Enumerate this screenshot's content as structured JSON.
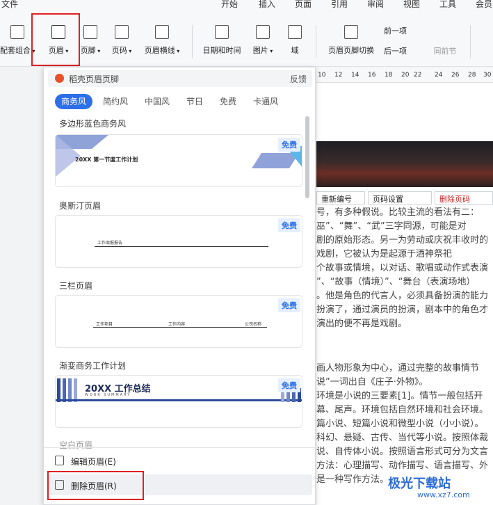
{
  "menubar": {
    "items": [
      "文件",
      "开始",
      "插入",
      "页面",
      "引用",
      "审阅",
      "视图",
      "工具",
      "会员"
    ]
  },
  "ribbon": {
    "buttons": [
      {
        "id": "combo",
        "label": "配套组合"
      },
      {
        "id": "header",
        "label": "页眉"
      },
      {
        "id": "footer",
        "label": "页脚"
      },
      {
        "id": "page-number",
        "label": "页码"
      },
      {
        "id": "header-line",
        "label": "页眉横线"
      },
      {
        "id": "datetime",
        "label": "日期和时间"
      },
      {
        "id": "picture",
        "label": "图片"
      },
      {
        "id": "field",
        "label": "域"
      },
      {
        "id": "switch",
        "label": "页眉页脚切换"
      },
      {
        "id": "prev",
        "label": "前一项"
      },
      {
        "id": "next",
        "label": "后一项"
      },
      {
        "id": "same",
        "label": "同前节"
      }
    ]
  },
  "ruler": {
    "ticks": [
      "10",
      "12",
      "14",
      "16",
      "18",
      "20",
      "22",
      "24",
      "26",
      "28",
      "30"
    ]
  },
  "header_toolbar": {
    "renumber": "重新编号",
    "page_number_settings": "页码设置",
    "delete_page_number": "删除页码"
  },
  "document_lines": [
    "号，有多种假说。比较主流的看法有二：",
    "巫”、“舞”、“武”三字同源，可能是对",
    "剧的原始形态。另一为劳动或庆祝丰收时的",
    "戏剧，它被认为是起源于酒神祭祀",
    "个故事或情境，以对话、歌唱或动作式表演",
    "”、“故事（情境）”、“舞台（表演场地）",
    "。他是角色的代言人，必须具备扮演的能力",
    "扮演了，通过演员的扮演，剧本中的角色才",
    "演出的便不再是戏剧。",
    "",
    "画人物形象为中心，通过完整的故事情节",
    "说”一词出自《庄子·外物》。",
    "环境是小说的三要素[1]。情节一般包括开",
    "幕、尾声。环境包括自然环境和社会环境。",
    "篇小说、短篇小说和微型小说（小小说）。",
    "科幻、悬疑、古传、当代等小说。按照体裁",
    "说、自传体小说。按照语言形式可分为文言",
    "方法：心理描写、动作描写、语言描写、外",
    "是一种写作方法。"
  ],
  "panel": {
    "title": "稻壳页眉页脚",
    "feedback": "反馈",
    "tabs": [
      "商务风",
      "简约风",
      "中国风",
      "节日",
      "免费",
      "卡通风"
    ],
    "active_tab": "商务风",
    "templates": [
      {
        "name": "多边形蓝色商务风",
        "badge": "免费",
        "preview_text": "20XX 第一节度工作计划"
      },
      {
        "name": "奥斯汀页眉",
        "badge": "免费",
        "preview_text": "工作周报报告"
      },
      {
        "name": "三栏页眉",
        "badge": "免费",
        "preview_cols": [
          "工作项目",
          "工作内容",
          "公司名称"
        ]
      },
      {
        "name": "渐变商务工作计划",
        "badge": "免费",
        "preview_title": "20XX 工作总结",
        "preview_sub": "WORK SUMMARY"
      }
    ],
    "partial_section": "空白页眉",
    "actions": {
      "edit": "编辑页眉(E)",
      "delete": "删除页眉(R)"
    }
  },
  "watermark": {
    "brand": "极光下载站",
    "url": "www.xz7.com"
  },
  "colors": {
    "accent": "#2d6fe8",
    "highlight_box": "#e02020",
    "brand_logo": "#e8502a"
  }
}
